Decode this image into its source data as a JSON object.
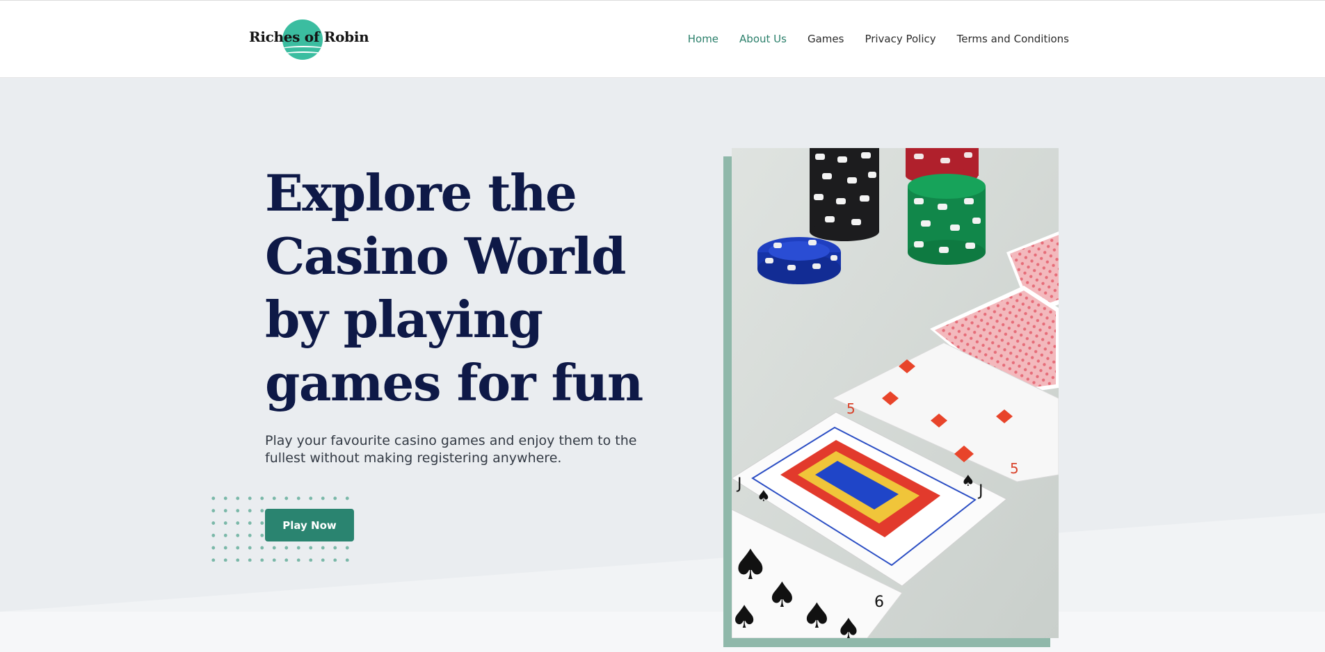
{
  "brand": {
    "name": "Riches of Robin"
  },
  "nav": {
    "items": [
      {
        "label": "Home",
        "active": true
      },
      {
        "label": "About Us",
        "active": true
      },
      {
        "label": "Games",
        "active": false
      },
      {
        "label": "Privacy Policy",
        "active": false
      },
      {
        "label": "Terms and Conditions",
        "active": false
      }
    ]
  },
  "hero": {
    "title": "Explore the Casino World by playing games for fun",
    "subtitle": "Play your favourite casino games and enjoy them to the fullest without making registering anywhere.",
    "cta_label": "Play Now"
  },
  "colors": {
    "accent": "#2a8470",
    "heading": "#0e1947",
    "logo_circle": "#3bbda0",
    "background": "#eaedf0"
  }
}
